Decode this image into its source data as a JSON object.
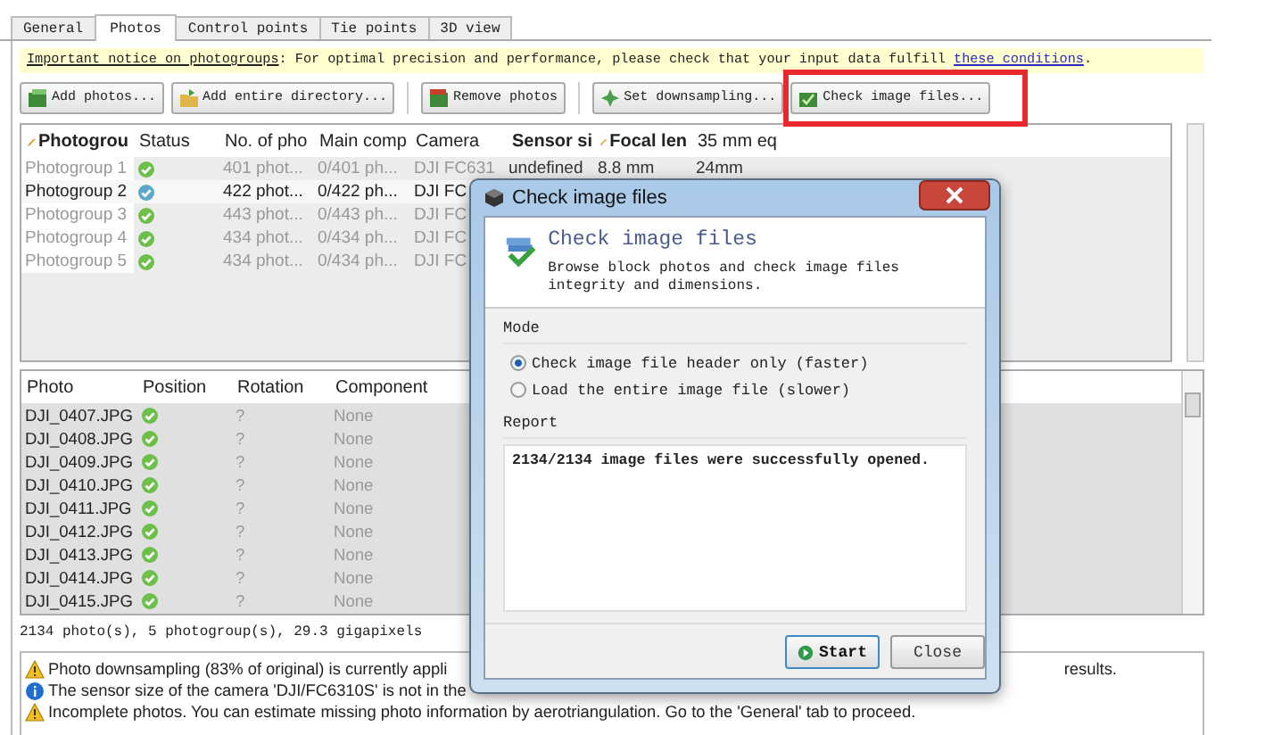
{
  "tabs": [
    {
      "label": "General",
      "selected": false
    },
    {
      "label": "Photos",
      "selected": true
    },
    {
      "label": "Control points",
      "selected": false
    },
    {
      "label": "Tie points",
      "selected": false
    },
    {
      "label": "3D view",
      "selected": false
    }
  ],
  "notice": {
    "link": "Important notice on photogroups",
    "text": ": For optimal precision and performance, please check that your input data fulfill ",
    "link_end": "these conditions",
    "end": "."
  },
  "toolbar": [
    {
      "label": "Add photos...",
      "kind": "add",
      "highlighted": false
    },
    {
      "label": "Add entire directory...",
      "kind": "folder",
      "highlighted": false
    },
    {
      "label": "Remove photos",
      "kind": "remove",
      "highlighted": false
    },
    {
      "label": "Set downsampling...",
      "kind": "gear",
      "highlighted": false
    },
    {
      "label": "Check image files...",
      "kind": "check",
      "highlighted": true
    }
  ],
  "photogroups": {
    "columns": [
      "Photogrou",
      "Status",
      "No. of pho",
      "Main comp",
      "Camera",
      "Sensor si",
      "Focal len",
      "35 mm eq"
    ],
    "rows": [
      {
        "status_ok": true,
        "selected": false,
        "cells": [
          "Photogroup 1",
          "",
          "401 phot...",
          "0/401 ph...",
          "DJI FC631",
          "undefined",
          "8.8 mm",
          "24mm"
        ]
      },
      {
        "status_ok": true,
        "selected": true,
        "cells": [
          "Photogroup 2",
          "",
          "422 phot...",
          "0/422 ph...",
          "DJI FC"
        ]
      },
      {
        "status_ok": true,
        "selected": false,
        "cells": [
          "Photogroup 3",
          "",
          "443 phot...",
          "0/443 ph...",
          "DJI FC"
        ]
      },
      {
        "status_ok": true,
        "selected": false,
        "cells": [
          "Photogroup 4",
          "",
          "434 phot...",
          "0/434 ph...",
          "DJI FC"
        ]
      },
      {
        "status_ok": true,
        "selected": false,
        "cells": [
          "Photogroup 5",
          "",
          "434 phot...",
          "0/434 ph...",
          "DJI FC"
        ]
      }
    ]
  },
  "photos": {
    "columns": [
      "Photo",
      "Position",
      "Rotation",
      "Component"
    ],
    "rows": [
      {
        "position_ok": true,
        "cells": [
          "DJI_0407.JPG",
          "",
          "?",
          "None"
        ]
      },
      {
        "position_ok": true,
        "cells": [
          "DJI_0408.JPG",
          "",
          "?",
          "None"
        ]
      },
      {
        "position_ok": true,
        "cells": [
          "DJI_0409.JPG",
          "",
          "?",
          "None"
        ]
      },
      {
        "position_ok": true,
        "cells": [
          "DJI_0410.JPG",
          "",
          "?",
          "None"
        ]
      },
      {
        "position_ok": true,
        "cells": [
          "DJI_0411.JPG",
          "",
          "?",
          "None"
        ]
      },
      {
        "position_ok": true,
        "cells": [
          "DJI_0412.JPG",
          "",
          "?",
          "None"
        ]
      },
      {
        "position_ok": true,
        "cells": [
          "DJI_0413.JPG",
          "",
          "?",
          "None"
        ]
      },
      {
        "position_ok": true,
        "cells": [
          "DJI_0414.JPG",
          "",
          "?",
          "None"
        ]
      },
      {
        "position_ok": true,
        "cells": [
          "DJI_0415.JPG",
          "",
          "?",
          "None"
        ]
      }
    ]
  },
  "summary": "2134 photo(s), 5 photogroup(s), 29.3 gigapixels",
  "messages": [
    {
      "kind": "warning",
      "text": "Photo downsampling (83% of original) is currently appli",
      "tail": "results."
    },
    {
      "kind": "info",
      "text": "The sensor size of the camera 'DJI/FC6310S' is not in the"
    },
    {
      "kind": "warning",
      "text": "Incomplete photos. You can estimate missing photo information by aerotriangulation. Go to the 'General' tab to proceed."
    }
  ],
  "dialog": {
    "title": "Check image files",
    "heading": "Check image files",
    "description": "Browse block photos and check image files integrity and dimensions.",
    "mode_label": "Mode",
    "modes": [
      {
        "label": "Check image file header only (faster)",
        "selected": true
      },
      {
        "label": "Load the entire image file (slower)",
        "selected": false
      }
    ],
    "report_label": "Report",
    "report": "2134/2134 image files were successfully opened.",
    "buttons": [
      {
        "label": "Start",
        "kind": "primary"
      },
      {
        "label": "Close",
        "kind": "plain"
      }
    ]
  }
}
